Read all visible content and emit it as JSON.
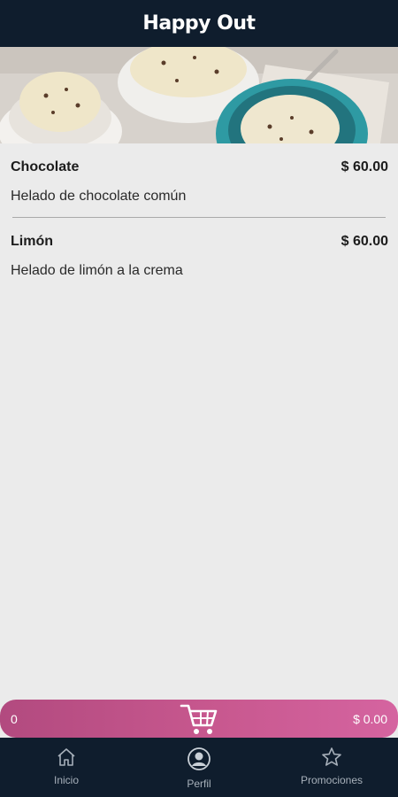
{
  "header": {
    "brand": "Happy Out"
  },
  "hero": {
    "description": "ice-cream-bowls-image"
  },
  "products": [
    {
      "name": "Chocolate",
      "price": "$ 60.00",
      "description": "Helado de chocolate común"
    },
    {
      "name": "Limón",
      "price": "$ 60.00",
      "description": "Helado de limón a la crema"
    }
  ],
  "cart": {
    "count": "0",
    "total": "$ 0.00",
    "icon": "cart-icon"
  },
  "nav": {
    "items": [
      {
        "label": "Inicio",
        "icon": "home-icon"
      },
      {
        "label": "Perfil",
        "icon": "user-icon"
      },
      {
        "label": "Promociones",
        "icon": "star-icon"
      }
    ]
  },
  "colors": {
    "header_bg": "#0f1d2d",
    "cart_gradient_start": "#b24a7f",
    "cart_gradient_end": "#d564a0",
    "nav_label": "#a7b0ba"
  }
}
